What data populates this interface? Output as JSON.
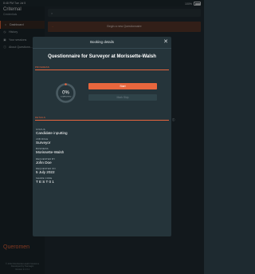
{
  "status_bar": {
    "time": "8:48 PM  Tue Jul 5",
    "battery": "100%"
  },
  "sidebar": {
    "brand": "Criternal",
    "brand_sub": "Credentials",
    "items": [
      {
        "label": "Dashboard",
        "icon": "home-icon"
      },
      {
        "label": "History",
        "icon": "history-icon"
      },
      {
        "label": "Your sessions",
        "icon": "sessions-icon"
      },
      {
        "label": "About Questionn...",
        "icon": "info-icon"
      }
    ],
    "logo": "Queromen",
    "footer_lines": [
      "© 2022 Worldwide Health Solutions",
      "Developed by Tasmagic",
      "Version 2.1.0.1"
    ]
  },
  "main": {
    "search_icon": "search-icon",
    "banner_label": "Begin a new Questionnaire"
  },
  "modal": {
    "header_title": "Booking details",
    "close_icon": "close-icon",
    "title": "Questionnaire for Surveyor at Morissette-Walsh",
    "progress_section": "PROGRESS",
    "progress_value": 0,
    "progress_text": "0%",
    "progress_caption": "COMPLETED",
    "start_label": "Start",
    "skip_label": "Mark Skip",
    "details_section": "DETAILS",
    "fields": [
      {
        "label": "STATUS",
        "value": "Candidate inputting"
      },
      {
        "label": "JOB ROLE",
        "value": "Surveyor"
      },
      {
        "label": "BUSINESS",
        "value": "Morissette-Walsh"
      },
      {
        "label": "REQUESTED BY",
        "value": "John Doe"
      },
      {
        "label": "REQUESTED ON",
        "value": "5 July 2022"
      },
      {
        "label": "SHARE CODE",
        "value": "TEST01"
      }
    ]
  },
  "colors": {
    "accent": "#e8663d",
    "modal_bg": "#25343a",
    "app_bg": "#1e2a30"
  }
}
